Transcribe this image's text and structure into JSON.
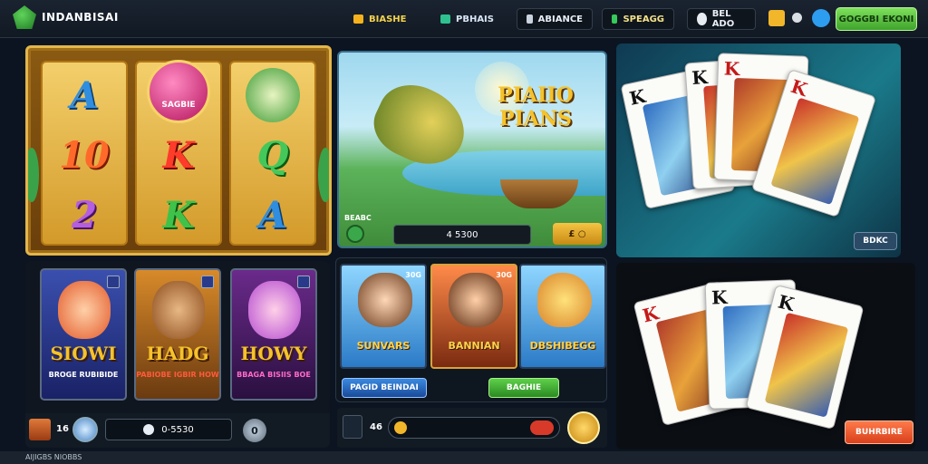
{
  "header": {
    "brand": "INDANBISAI",
    "nav": [
      {
        "label": "BIASHE"
      },
      {
        "label": "PBHAIS"
      },
      {
        "label": "ABIANCE"
      },
      {
        "label": "SPEAGG"
      },
      {
        "label": "BEL ADO"
      }
    ],
    "cta_label": "GOGGBI EKONI"
  },
  "slots": {
    "reels": [
      [
        "A",
        "10",
        "2"
      ],
      [
        "",
        "K",
        "K"
      ],
      [
        "",
        "Q",
        "A"
      ]
    ],
    "badge_text": "SAGBIE"
  },
  "fishing": {
    "title": "PIAIIO PIANS",
    "tag": "BEABC",
    "balance": "4 5300",
    "button_label": "£ ○"
  },
  "cards_top": {
    "ranks": [
      "K",
      "K",
      "K",
      "K"
    ],
    "button_label": "BDKC"
  },
  "cards_bottom": {
    "ranks": [
      "K",
      "K",
      "K"
    ],
    "button_label": "BUHRBIRE"
  },
  "heroes": {
    "items": [
      {
        "title": "SIOWI",
        "sub": "BROGE RUBIBIDE"
      },
      {
        "title": "HADG",
        "sub": "PABIOBE IGBIR HOW"
      },
      {
        "title": "HOWY",
        "sub": "BBAGA BISIIS BOE"
      }
    ],
    "count": "16",
    "balance": "0-5530",
    "button_label": "0"
  },
  "games": {
    "items": [
      {
        "title": "SUNVARS",
        "tag": "30G"
      },
      {
        "title": "BANNIAN",
        "tag": "30G"
      },
      {
        "title": "DBSHIBEGG",
        "tag": ""
      }
    ],
    "primary_button": "PAGID BEINDAI",
    "secondary_button": "BAGHIE",
    "count": "46"
  },
  "footer": {
    "text": "AIJIGBS NIOBBS"
  }
}
